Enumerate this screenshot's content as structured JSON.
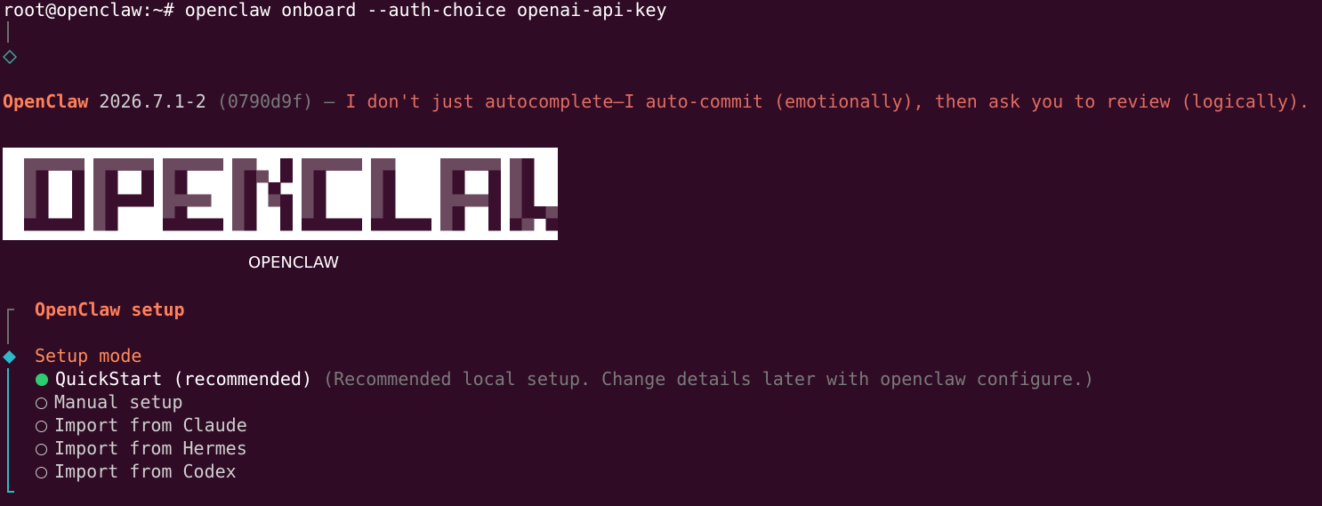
{
  "terminal": {
    "prompt": "root@openclaw:~#",
    "command": "openclaw onboard --auth-choice openai-api-key"
  },
  "banner": {
    "app_name": "OpenClaw",
    "version": "2026.7.1-2",
    "commit": "(0790d9f)",
    "dash": "—",
    "tagline": "I don't just autocomplete—I auto-commit (emotionally), then ask you to review (logically)."
  },
  "logo": {
    "caption": "OPENCLAW"
  },
  "setup": {
    "title": "OpenClaw setup",
    "mode_label": "Setup mode",
    "options": [
      {
        "label": "QuickStart (recommended)",
        "hint": "(Recommended local setup. Change details later with openclaw configure.)",
        "selected": true
      },
      {
        "label": "Manual setup",
        "selected": false
      },
      {
        "label": "Import from Claude",
        "selected": false
      },
      {
        "label": "Import from Hermes",
        "selected": false
      },
      {
        "label": "Import from Codex",
        "selected": false
      }
    ]
  },
  "colors": {
    "background": "#2f0b25",
    "accent": "#ff8059",
    "tagline": "#e06c60",
    "selected_radio": "#2ecc71",
    "active_gutter": "#2eb8c9"
  },
  "icons": {
    "step_done": "hollow-diamond-icon",
    "step_active": "filled-diamond-icon",
    "radio_on": "filled-circle-icon",
    "radio_off": "hollow-circle-icon"
  }
}
